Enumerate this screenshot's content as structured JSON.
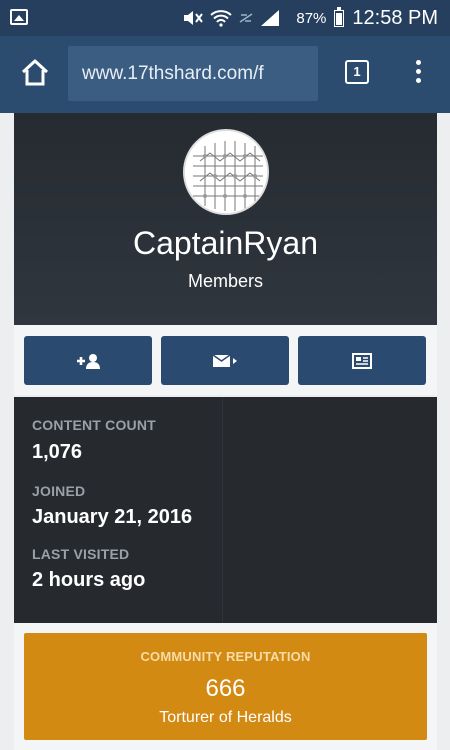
{
  "status_bar": {
    "battery_percent": "87%",
    "time": "12:58 PM"
  },
  "browser": {
    "url": "www.17thshard.com/f",
    "tab_count": "1"
  },
  "profile": {
    "username": "CaptainRyan",
    "group": "Members"
  },
  "actions": [
    {
      "icon": "add-friend-icon"
    },
    {
      "icon": "message-icon"
    },
    {
      "icon": "content-icon"
    }
  ],
  "stats": {
    "content_count_label": "CONTENT COUNT",
    "content_count": "1,076",
    "joined_label": "JOINED",
    "joined": "January 21, 2016",
    "last_visited_label": "LAST VISITED",
    "last_visited": "2 hours ago"
  },
  "reputation": {
    "label": "COMMUNITY REPUTATION",
    "value": "666",
    "title": "Torturer of Heralds"
  },
  "colors": {
    "status_bar": "#263f5e",
    "browser_bar": "#2c4c6f",
    "button": "#2b4a6f",
    "reputation": "#d38a13"
  }
}
